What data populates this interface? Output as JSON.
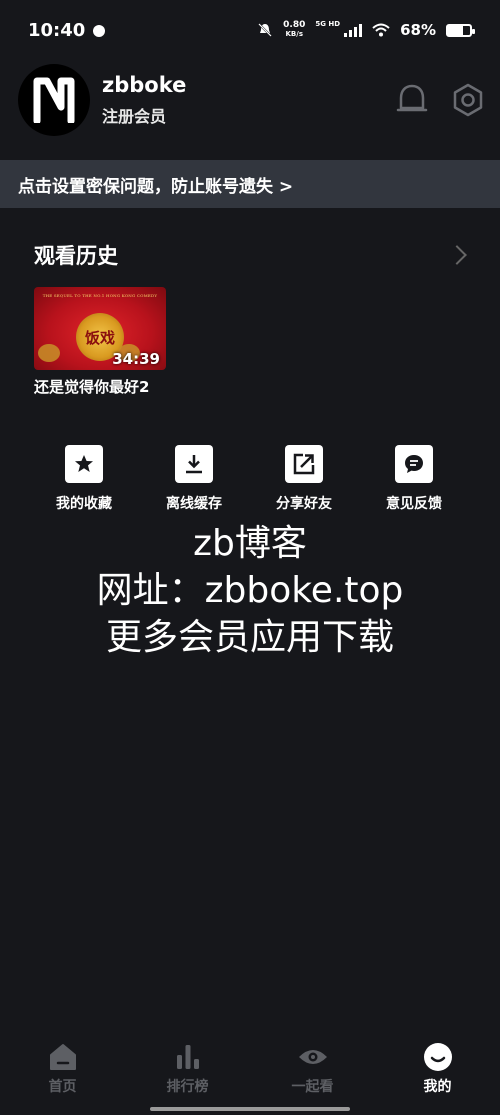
{
  "status_bar": {
    "time": "10:40",
    "net_speed_value": "0.80",
    "net_speed_unit": "KB/s",
    "signal_label": "5G HD",
    "battery": "68%",
    "battery_level": 0.68
  },
  "profile": {
    "username": "zbboke",
    "member_status": "注册会员",
    "icons": [
      "bell-icon",
      "settings-icon"
    ]
  },
  "banner": {
    "text": "点击设置密保问题，防止账号遗失 >"
  },
  "history": {
    "title": "观看历史",
    "items": [
      {
        "title": "还是觉得你最好2",
        "duration": "34:39",
        "thumb_caption": "THE SEQUEL TO THE NO.1 HONG KONG COMEDY",
        "thumb_emblem": "饭戏"
      }
    ]
  },
  "actions": [
    {
      "label": "我的收藏",
      "icon": "star-icon"
    },
    {
      "label": "离线缓存",
      "icon": "download-icon"
    },
    {
      "label": "分享好友",
      "icon": "share-icon"
    },
    {
      "label": "意见反馈",
      "icon": "feedback-icon"
    }
  ],
  "watermark": {
    "line1": "zb博客",
    "line2": "网址：zbboke.top",
    "line3": "更多会员应用下载"
  },
  "bottom_nav": [
    {
      "label": "首页",
      "icon": "home-icon",
      "active": false
    },
    {
      "label": "排行榜",
      "icon": "ranking-icon",
      "active": false
    },
    {
      "label": "一起看",
      "icon": "eye-icon",
      "active": false
    },
    {
      "label": "我的",
      "icon": "profile-icon",
      "active": true
    }
  ],
  "colors": {
    "background": "#16171b",
    "banner": "#32363e",
    "nav_inactive": "#5d5f64"
  }
}
